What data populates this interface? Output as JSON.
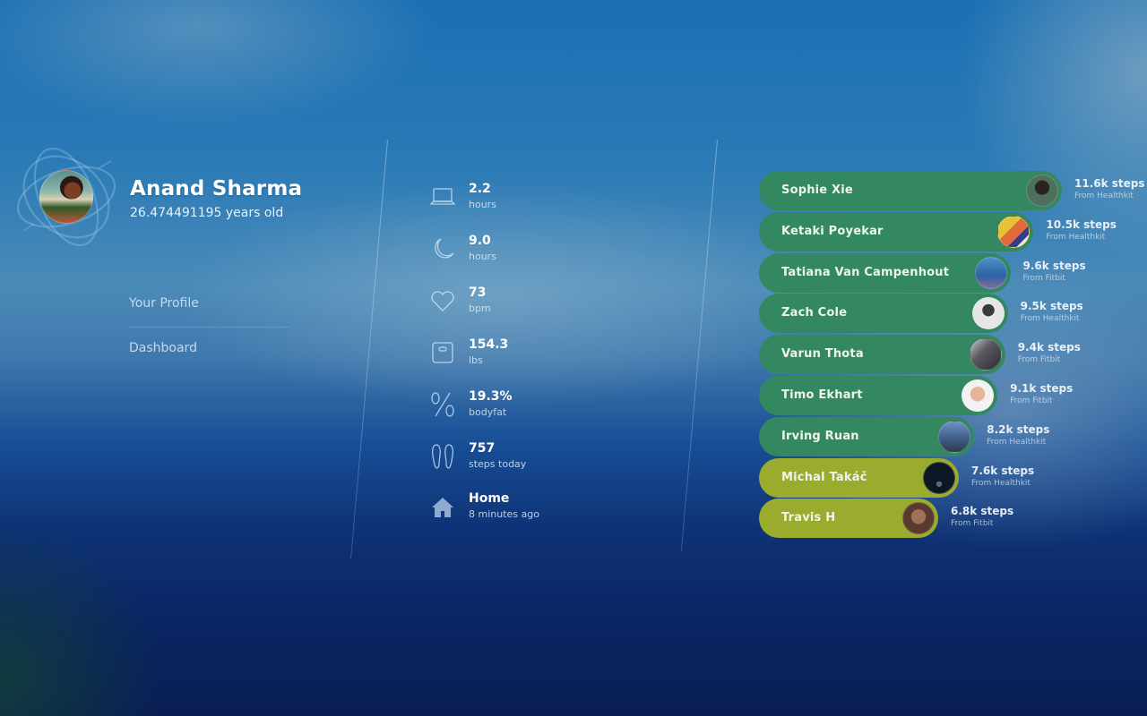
{
  "profile": {
    "name": "Anand Sharma",
    "age": "26.474491195 years old",
    "avatar_icon": "user-photo"
  },
  "nav": {
    "items": [
      {
        "label": "Your Profile"
      },
      {
        "label": "Dashboard"
      }
    ]
  },
  "stats": [
    {
      "icon": "laptop-icon",
      "value": "2.2",
      "unit": "hours"
    },
    {
      "icon": "moon-icon",
      "value": "9.0",
      "unit": "hours"
    },
    {
      "icon": "heart-icon",
      "value": "73",
      "unit": "bpm"
    },
    {
      "icon": "scale-icon",
      "value": "154.3",
      "unit": "lbs"
    },
    {
      "icon": "percent-icon",
      "value": "19.3%",
      "unit": "bodyfat"
    },
    {
      "icon": "footprints-icon",
      "value": "757",
      "unit": "steps today"
    },
    {
      "icon": "home-icon",
      "value": "Home",
      "unit": "8 minutes ago"
    }
  ],
  "leaderboard": {
    "colors": {
      "high": "#338862",
      "low": "#9aab2e"
    },
    "entries": [
      {
        "name": "Sophie Xie",
        "steps": "11.6k steps",
        "steps_k": 11.6,
        "source": "From Healthkit",
        "tier": "high"
      },
      {
        "name": "Ketaki Poyekar",
        "steps": "10.5k steps",
        "steps_k": 10.5,
        "source": "From Healthkit",
        "tier": "high"
      },
      {
        "name": "Tatiana Van Campenhout",
        "steps": "9.6k steps",
        "steps_k": 9.6,
        "source": "From Fitbit",
        "tier": "high"
      },
      {
        "name": "Zach Cole",
        "steps": "9.5k steps",
        "steps_k": 9.5,
        "source": "From Healthkit",
        "tier": "high"
      },
      {
        "name": "Varun Thota",
        "steps": "9.4k steps",
        "steps_k": 9.4,
        "source": "From Fitbit",
        "tier": "high"
      },
      {
        "name": "Timo Ekhart",
        "steps": "9.1k steps",
        "steps_k": 9.1,
        "source": "From Fitbit",
        "tier": "high"
      },
      {
        "name": "Irving Ruan",
        "steps": "8.2k steps",
        "steps_k": 8.2,
        "source": "From Healthkit",
        "tier": "high"
      },
      {
        "name": "Michal Takáč",
        "steps": "7.6k steps",
        "steps_k": 7.6,
        "source": "From Healthkit",
        "tier": "low"
      },
      {
        "name": "Travis H",
        "steps": "6.8k steps",
        "steps_k": 6.8,
        "source": "From Fitbit",
        "tier": "low"
      }
    ]
  }
}
